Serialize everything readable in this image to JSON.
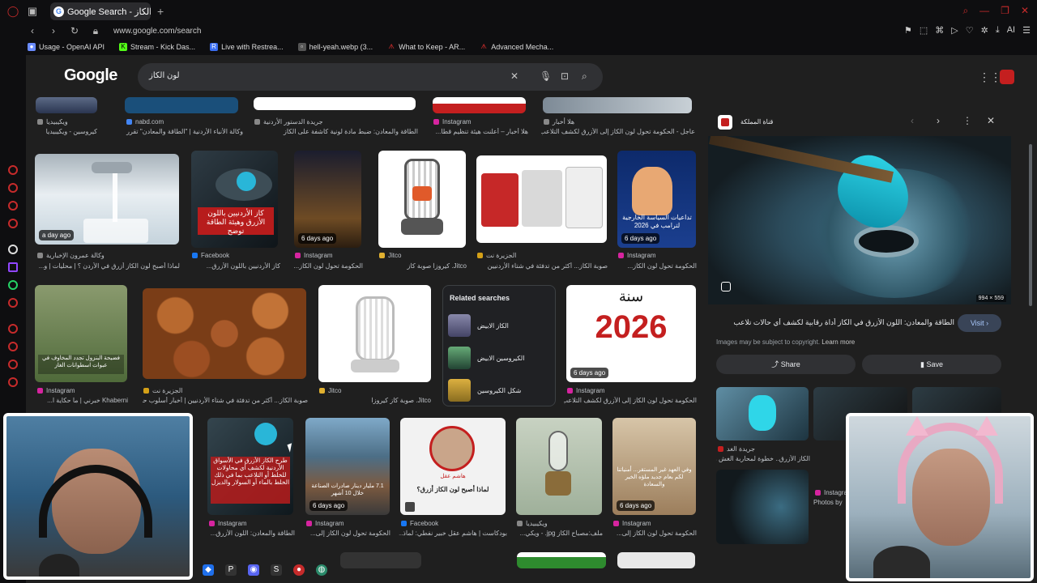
{
  "browser": {
    "tab_title": "Google Search - لون الكاز",
    "url": "www.google.com/search",
    "bookmarks": [
      {
        "label": "Usage - OpenAI API",
        "color": "#6a8cff"
      },
      {
        "label": "Stream - Kick Das...",
        "color": "#53fc18"
      },
      {
        "label": "Live with Restrea...",
        "color": "#3a6df0"
      },
      {
        "label": "hell-yeah.webp (3...",
        "color": "#888888"
      },
      {
        "label": "What to Keep - AR...",
        "color": "#c62b2b"
      },
      {
        "label": "Advanced Mecha...",
        "color": "#c62b2b"
      }
    ]
  },
  "search": {
    "logo": "Google",
    "query": "لون الكاز"
  },
  "results": {
    "row0": [
      {
        "source": "ويكيبيديا",
        "caption": "كيروسين - ويكيبيديا"
      },
      {
        "source": "nabd.com",
        "caption": "وكالة الأنباء الأردنية | \"الطاقة والمعادن\" تقرر إضافة..."
      },
      {
        "source": "جريدة الدستور الأردنية",
        "caption": "الطاقة والمعادن: ضبط مادة لونية كاشفة على الكاز"
      },
      {
        "source": "Instagram",
        "caption": "هلا أخبار – أعلنت هيئة تنظيم قطا..."
      },
      {
        "source": "هلا أخبار",
        "caption": "عاجل - الحكومة تحول لون الكاز إلى الأزرق لكشف التلاعب"
      }
    ],
    "row1": [
      {
        "badge": "a day ago",
        "source": "وكالة عمرون الإخبارية",
        "caption": "لماذا أصبح لون الكاز أزرق في الأردن ؟ | محليات | و..."
      },
      {
        "badge": "",
        "source": "Facebook",
        "caption": "كاز الأردنيين باللون الأزرق..."
      },
      {
        "badge": "6 days ago",
        "source": "Instagram",
        "caption": "الحكومة تحول لون الكاز..."
      },
      {
        "badge": "",
        "source": "Jitco",
        "caption": "Jitco. كيروزا صوبة كاز"
      },
      {
        "badge": "",
        "source": "الجزيرة نت",
        "caption": "صوبة الكاز... أكثر من تدفئة في شتاء الأردنيين"
      },
      {
        "badge": "6 days ago",
        "source": "Instagram",
        "caption": "الحكومة تحول لون الكاز..."
      }
    ],
    "row2": [
      {
        "badge": "",
        "source": "Instagram",
        "caption": "Khaberni خبرني | ما حكاية ا..."
      },
      {
        "badge": "",
        "source": "الجزيرة نت",
        "caption": "صوبة الكاز... أكثر من تدفئة في شتاء الأردنيين | أخبار أسلوب حـ..."
      },
      {
        "badge": "",
        "source": "Jitco",
        "caption": "Jitco. صوبة كاز كيروزا"
      },
      {
        "badge": "6 days ago",
        "source": "Instagram",
        "caption": "الحكومة تحول لون الكاز إلى الأزرق لكشف التلاعب"
      }
    ],
    "row3": [
      {
        "badge": "",
        "source": "Instagram",
        "caption": "الطاقة والمعادن: اللون الأزرق..."
      },
      {
        "badge": "6 days ago",
        "source": "Instagram",
        "caption": "الحكومة تحول لون الكاز إلى..."
      },
      {
        "badge": "",
        "source": "Facebook",
        "caption": "بودكاست | هاشم عقل خبير نفطي: لماذ..."
      },
      {
        "badge": "",
        "source": "ويكيبيديا",
        "caption": "ملف:مصباح الكاز jpg. - ويكي..."
      },
      {
        "badge": "6 days ago",
        "source": "Instagram",
        "caption": "الحكومة تحول لون الكاز إلى..."
      }
    ],
    "image_texts": {
      "kaz_blue": "كاز الأردنيين باللون الأزرق وهيئة الطاقة توضح",
      "year": "2026",
      "related_year_word": "سنة",
      "kaz_blue2": "طرح الكاز الأزرق في الأسواق الأردنية لكشف أي محاولات للخلط أو التلاعب بما في ذلك الخلط بالماء أو السولار والديزل",
      "podcast": "لماذا أصبح لون الكاز أزرق؟",
      "podcast_name": "هاشم عقل",
      "news": "7.1 مليار دينار صادرات الصناعة خلال 10 أشهر",
      "trump": "تداعيات السياسة الخارجية لترامب في 2026",
      "benzene": "فضيحة البنزول تجدد المخاوف في عبوات اسطوانات الغاز",
      "family": "وفي العهد غير المستقر... أمنياتنا لكم بعام جديد ملؤه الخير والسعادة"
    }
  },
  "related_searches": {
    "title": "Related searches",
    "items": [
      "الكاز الابيض",
      "الكيروسين الابيض",
      "شكل الكيروسين"
    ]
  },
  "panel": {
    "source": "قناة المملكة",
    "dimensions": "994 × 559",
    "title": "الطاقة والمعادن: اللون الأزرق في الكاز أداة رقابية لكشف أي حالات تلاعب",
    "visit": "Visit",
    "copyright": "Images may be subject to copyright.",
    "learn_more": "Learn more",
    "share": "Share",
    "save": "Save",
    "thumbs": [
      {
        "source": "جريدة الغد",
        "caption": "الكاز الأزرق.. خطوة لمحاربة الغش وحـ..."
      },
      {
        "source": "Instagram",
        "caption": "Photos by"
      }
    ]
  }
}
